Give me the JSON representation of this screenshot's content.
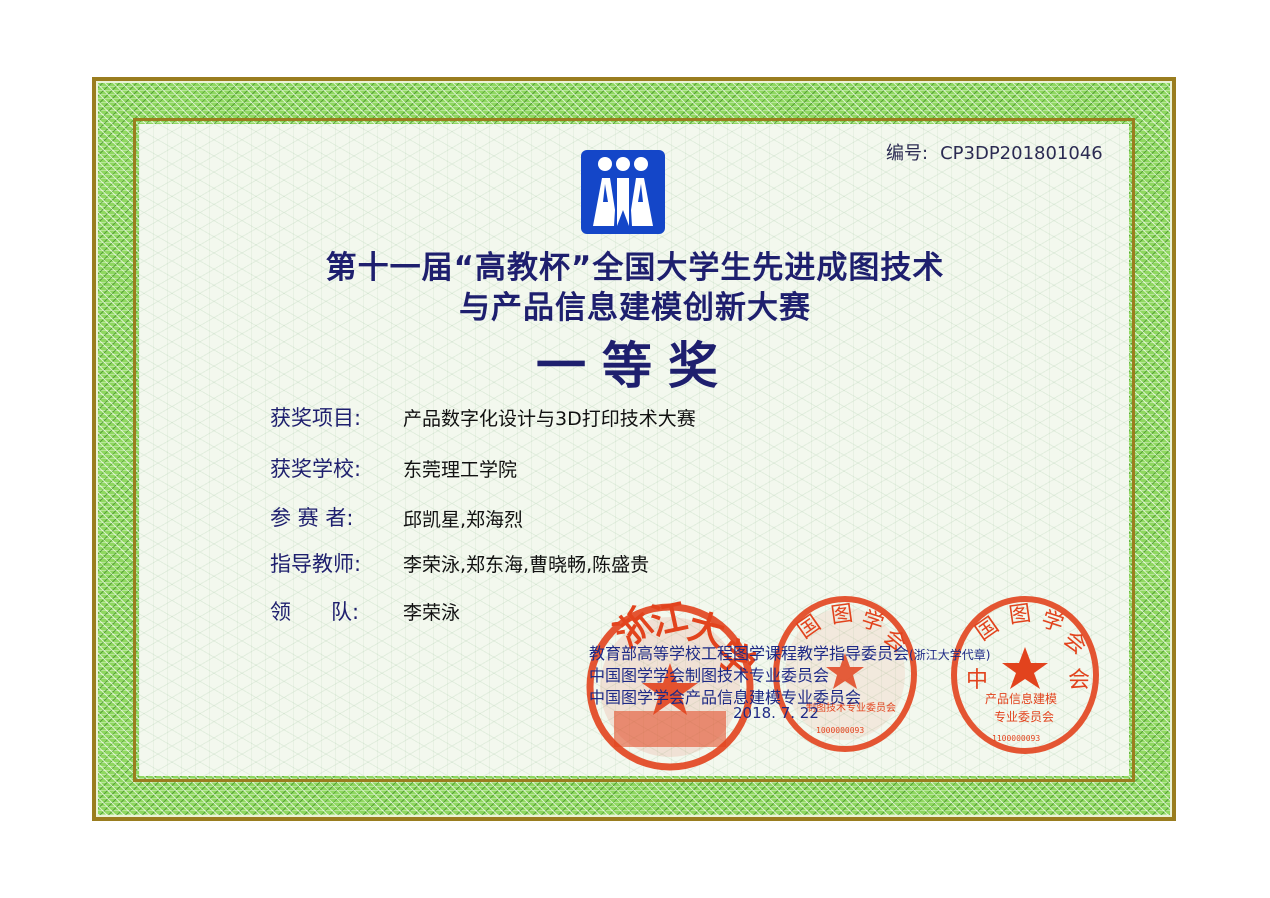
{
  "certificate": {
    "serial_label": "编号:",
    "serial_value": "CP3DP201801046",
    "logo_icon": "people-logo-icon",
    "title_line1": "第十一届“高教杯”全国大学生先进成图技术",
    "title_line2": "与产品信息建模创新大赛",
    "award": "一等奖",
    "fields": [
      {
        "label": "获奖项目:",
        "value": "产品数字化设计与3D打印技术大赛"
      },
      {
        "label": "获奖学校:",
        "value": "东莞理工学院"
      },
      {
        "label": "参 赛 者:",
        "value": "邱凯星,郑海烈"
      },
      {
        "label": "指导教师:",
        "value": "李荣泳,郑东海,曹晓畅,陈盛贵"
      },
      {
        "label": "领      队:",
        "value": "李荣泳"
      }
    ],
    "issuers": [
      {
        "name": "教育部高等学校工程图学课程教学指导委员会",
        "note": "(浙江大学代章)"
      },
      {
        "name": "中国图学学会制图技术专业委员会",
        "note": ""
      },
      {
        "name": "中国图学学会产品信息建模专业委员会",
        "note": ""
      }
    ],
    "date": "2018. 7. 22",
    "seals": [
      {
        "text": "浙江大学",
        "color": "#e2431d"
      },
      {
        "text": "中国图学学会 制图技术专业委员会",
        "color": "#e2431d"
      },
      {
        "text": "中国图学学会 产品信息建模专业委员会",
        "color": "#e2431d"
      }
    ]
  }
}
